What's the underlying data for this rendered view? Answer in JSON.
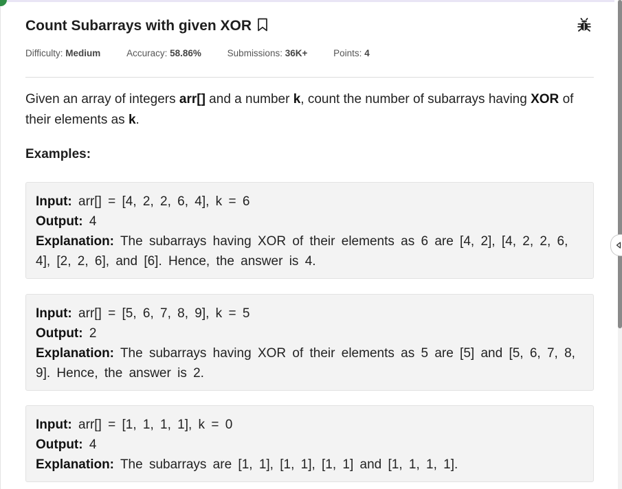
{
  "problem": {
    "title": "Count Subarrays with given XOR",
    "meta": {
      "difficulty_label": "Difficulty:",
      "difficulty_value": "Medium",
      "accuracy_label": "Accuracy:",
      "accuracy_value": "58.86%",
      "submissions_label": "Submissions:",
      "submissions_value": "36K+",
      "points_label": "Points:",
      "points_value": "4"
    },
    "description": {
      "t1": "Given an array of integers ",
      "b1": "arr[]",
      "t2": " and a number ",
      "b2": "k",
      "t3": ", count the number of subarrays having ",
      "b3": "XOR",
      "t4": " of their elements as ",
      "b4": "k",
      "t5": "."
    },
    "examples_heading": "Examples:",
    "examples": [
      {
        "input_label": "Input:",
        "input": "arr[] = [4, 2, 2, 6, 4], k = 6",
        "output_label": "Output:",
        "output": "4",
        "explanation_label": "Explanation:",
        "explanation": "The subarrays having XOR of their elements as 6 are [4, 2], [4, 2, 2, 6, 4], [2, 2, 6], and [6]. Hence, the answer is 4."
      },
      {
        "input_label": "Input:",
        "input": "arr[] = [5, 6, 7, 8, 9], k = 5",
        "output_label": "Output:",
        "output": "2",
        "explanation_label": "Explanation:",
        "explanation": "The subarrays having XOR of their elements as 5 are [5] and [5, 6, 7, 8, 9]. Hence, the answer is 2."
      },
      {
        "input_label": "Input:",
        "input": "arr[] = [1, 1, 1, 1], k = 0",
        "output_label": "Output:",
        "output": "4",
        "explanation_label": "Explanation:",
        "explanation": "The subarrays are [1, 1], [1, 1], [1, 1] and [1, 1, 1, 1]."
      }
    ]
  },
  "icons": {
    "bookmark": "bookmark-icon",
    "report": "bug-icon",
    "collapse": "chevron-left-icon"
  },
  "colors": {
    "brand": "#2f8d46",
    "example_bg": "#f3f3f3"
  }
}
